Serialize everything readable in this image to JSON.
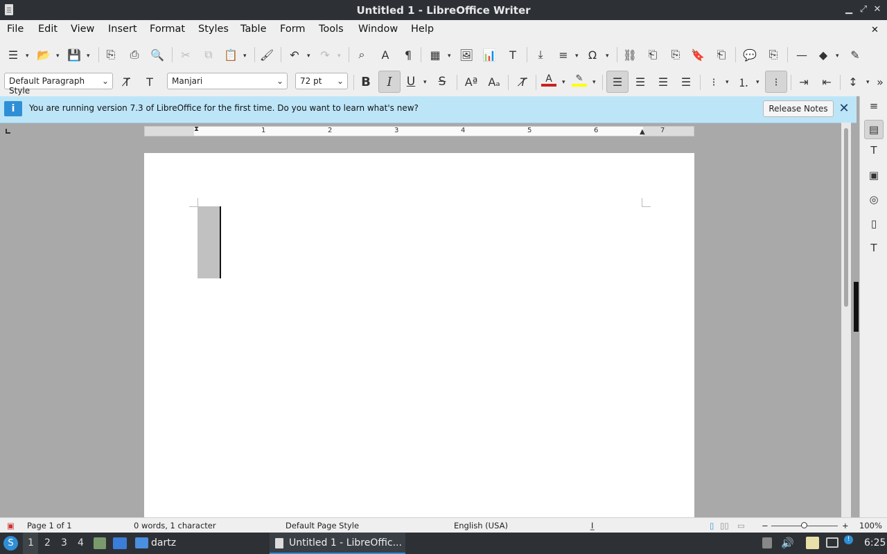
{
  "window": {
    "title": "Untitled 1 - LibreOffice Writer"
  },
  "menu": [
    "File",
    "Edit",
    "View",
    "Insert",
    "Format",
    "Styles",
    "Table",
    "Form",
    "Tools",
    "Window",
    "Help"
  ],
  "formatting": {
    "paragraph_style": "Default Paragraph Style",
    "font_name": "Manjari",
    "font_size": "72 pt",
    "bold": "B",
    "italic": "I",
    "underline": "U",
    "strike": "S"
  },
  "infobar": {
    "message": "You are running version 7.3 of LibreOffice for the first time. Do you want to learn what's new?",
    "button": "Release Notes"
  },
  "ruler": {
    "labels": [
      "1",
      "2",
      "3",
      "4",
      "5",
      "6",
      "7"
    ]
  },
  "status": {
    "page": "Page 1 of 1",
    "words": "0 words, 1 character",
    "page_style": "Default Page Style",
    "language": "English (USA)",
    "zoom": "100%"
  },
  "taskbar": {
    "workspaces": [
      "1",
      "2",
      "3",
      "4"
    ],
    "folder": "dartz",
    "task": "Untitled 1 - LibreOffic...",
    "clock": "6:25"
  },
  "colors": {
    "font_color": "#c9211e",
    "highlight": "#ffff00",
    "accent": "#2f8fd6"
  }
}
